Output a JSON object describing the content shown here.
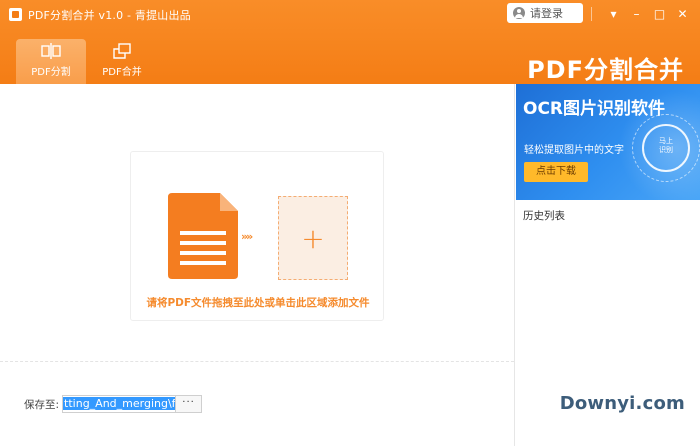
{
  "app": {
    "title": "PDF分割合并 v1.0 - 青提山出品",
    "brand": "PDF分割合并"
  },
  "titlebar": {
    "login_label": "请登录",
    "controls": [
      "▾",
      "–",
      "□",
      "✕"
    ]
  },
  "tabs": [
    {
      "label": "PDF分割",
      "icon": "split-icon",
      "active": true
    },
    {
      "label": "PDF合并",
      "icon": "merge-icon",
      "active": false
    }
  ],
  "main": {
    "drop_hint": "请将PDF文件拖拽至此处或单击此区域添加文件",
    "arrows": "»»",
    "plus": "+",
    "save_label": "保存至:",
    "save_path": "tting_And_merging\\file",
    "browse_label": "···"
  },
  "side": {
    "ad": {
      "title": "OCR图片识别软件",
      "subtitle": "轻松提取图片中的文字",
      "button": "点击下载",
      "badge_line1": "马上",
      "badge_line2": "识别"
    },
    "history_title": "历史列表"
  },
  "watermark": "Downyi.com",
  "colors": {
    "accent": "#f47d15",
    "ad_blue": "#1e6fd6",
    "ad_button": "#ffb92a"
  }
}
